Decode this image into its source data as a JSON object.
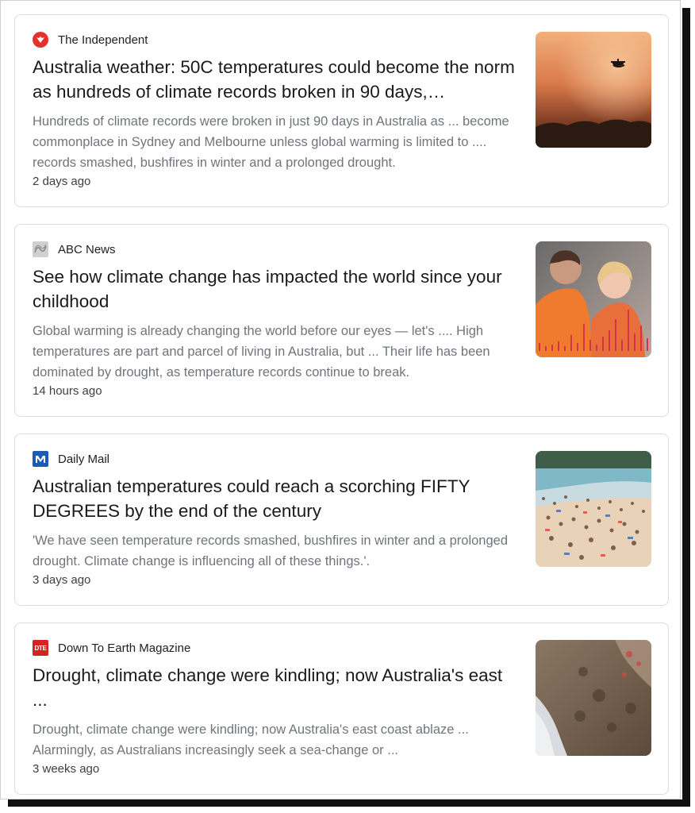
{
  "results": [
    {
      "source": "The Independent",
      "logo_text": "",
      "headline": "Australia weather: 50C temperatures could become the norm as hundreds of climate records broken in 90 days,…",
      "snippet": "Hundreds of climate records were broken in just 90 days in Australia as ... become commonplace in Sydney and Melbourne unless global warming is limited to .... records smashed, bushfires in winter and a prolonged drought.",
      "time": "2 days ago",
      "thumbnail_icon": "helicopter-over-bushfire-smoke-image"
    },
    {
      "source": "ABC News",
      "logo_text": "",
      "headline": "See how climate change has impacted the world since your childhood",
      "snippet": "Global warming is already changing the world before our eyes — let's .... High temperatures are part and parcel of living in Australia, but ... Their life has been dominated by drought, as temperature records continue to break.",
      "time": "14 hours ago",
      "thumbnail_icon": "mother-and-child-with-temperature-chart-image"
    },
    {
      "source": "Daily Mail",
      "logo_text": "",
      "headline": "Australian temperatures could reach a scorching FIFTY DEGREES by the end of the century",
      "snippet": "'We have seen temperature records smashed, bushfires in winter and a prolonged drought. Climate change is influencing all of these things.'.",
      "time": "3 days ago",
      "thumbnail_icon": "crowded-beach-image"
    },
    {
      "source": "Down To Earth Magazine",
      "logo_text": "DTE",
      "headline": "Drought, climate change were kindling; now Australia's east ...",
      "snippet": "Drought, climate change were kindling; now Australia's east coast ablaze ... Alarmingly, as Australians increasingly seek a sea-change or ...",
      "time": "3 weeks ago",
      "thumbnail_icon": "aerial-coastline-fire-image"
    }
  ]
}
